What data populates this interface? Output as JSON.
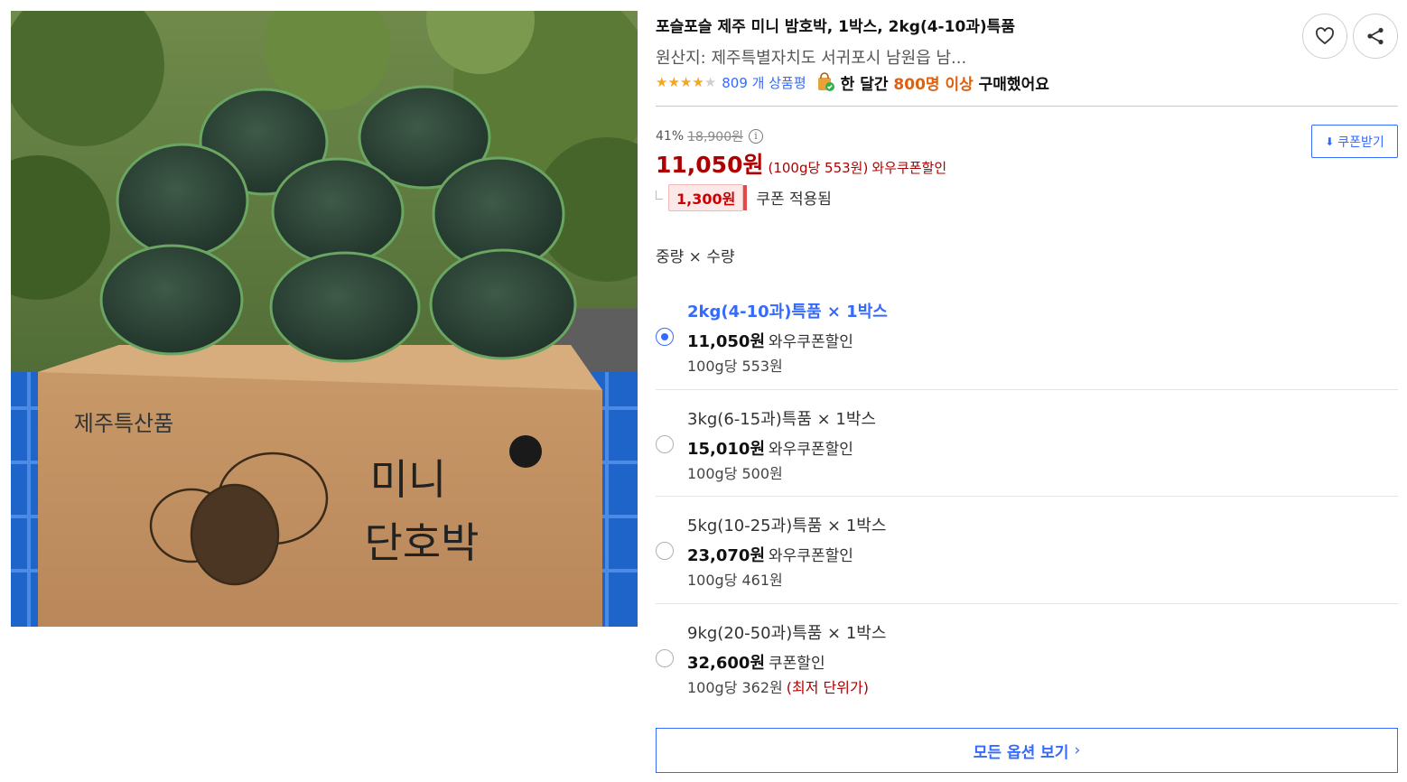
{
  "product": {
    "title": "포슬포슬 제주 미니 밤호박, 1박스, 2kg(4-10과)특품",
    "origin": "원산지: 제주특별자치도 서귀포시 남원읍 남...",
    "rating": 4,
    "max_rating": 5,
    "review_link": "809 개 상품평",
    "month_prefix": "한 달간",
    "month_highlight": "800명 이상",
    "month_suffix": "구매했어요",
    "image_texts": {
      "box_brand": "제주특산품",
      "box_line1": "미니",
      "box_line2": "단호박"
    }
  },
  "price": {
    "discount_rate": "41%",
    "original": "18,900원",
    "final": "11,050원",
    "unit_price": "(100g당 553원)",
    "tag": "와우쿠폰할인",
    "coupon_amount": "1,300원",
    "coupon_text": "쿠폰 적용됨",
    "coupon_button": "쿠폰받기"
  },
  "options_section": {
    "header": "중량 × 수량",
    "items": [
      {
        "name": "2kg(4-10과)특품 × 1박스",
        "price": "11,050원",
        "tag": "와우쿠폰할인",
        "unit": "100g당 553원",
        "best": "",
        "selected": true
      },
      {
        "name": "3kg(6-15과)특품 × 1박스",
        "price": "15,010원",
        "tag": "와우쿠폰할인",
        "unit": "100g당 500원",
        "best": "",
        "selected": false
      },
      {
        "name": "5kg(10-25과)특품 × 1박스",
        "price": "23,070원",
        "tag": "와우쿠폰할인",
        "unit": "100g당 461원",
        "best": "",
        "selected": false
      },
      {
        "name": "9kg(20-50과)특품 × 1박스",
        "price": "32,600원",
        "tag": "쿠폰할인",
        "unit": "100g당 362원",
        "best": "(최저 단위가)",
        "selected": false
      }
    ],
    "all_options_button": "모든 옵션 보기"
  },
  "colors": {
    "accent": "#346aff",
    "price_red": "#ae0000",
    "highlight_orange": "#e0600b",
    "star": "#f5a623"
  },
  "icons": {
    "wishlist": "heart-icon",
    "share": "share-icon",
    "coupon": "download-icon",
    "info": "info-icon",
    "bag": "shopping-bag-icon"
  }
}
